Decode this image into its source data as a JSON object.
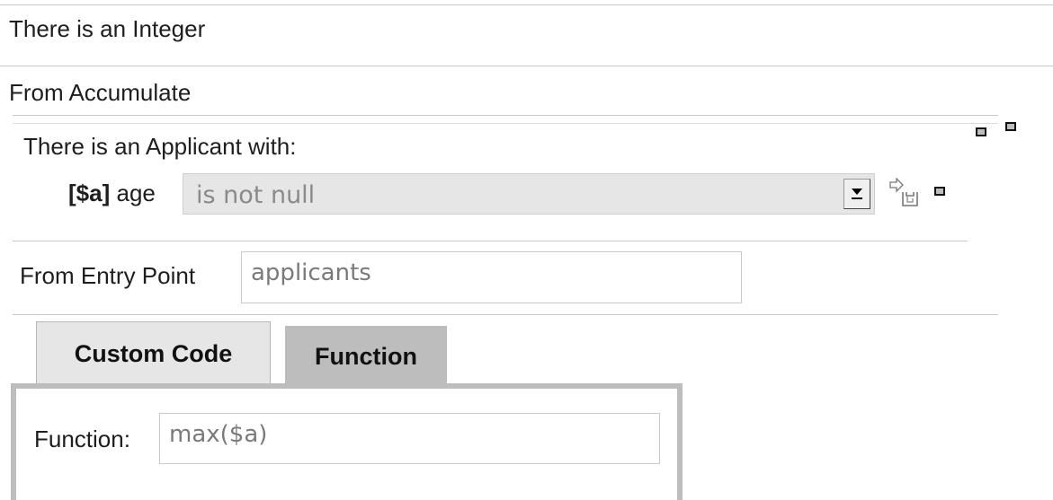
{
  "rows": {
    "integer_header": "There is an Integer",
    "accumulate_header": "From Accumulate",
    "applicant_header": "There is an Applicant with:"
  },
  "constraint": {
    "variable": "[$a]",
    "field": "age",
    "operator_selected": "is not null"
  },
  "entry_point": {
    "label": "From Entry Point",
    "value": "applicants"
  },
  "tabs": [
    {
      "label": "Custom Code",
      "active": false
    },
    {
      "label": "Function",
      "active": true
    }
  ],
  "function_panel": {
    "label": "Function:",
    "value": "max($a)"
  },
  "icons": {
    "remove": "minus-square-icon",
    "add_connective": "add-connective-icon"
  }
}
